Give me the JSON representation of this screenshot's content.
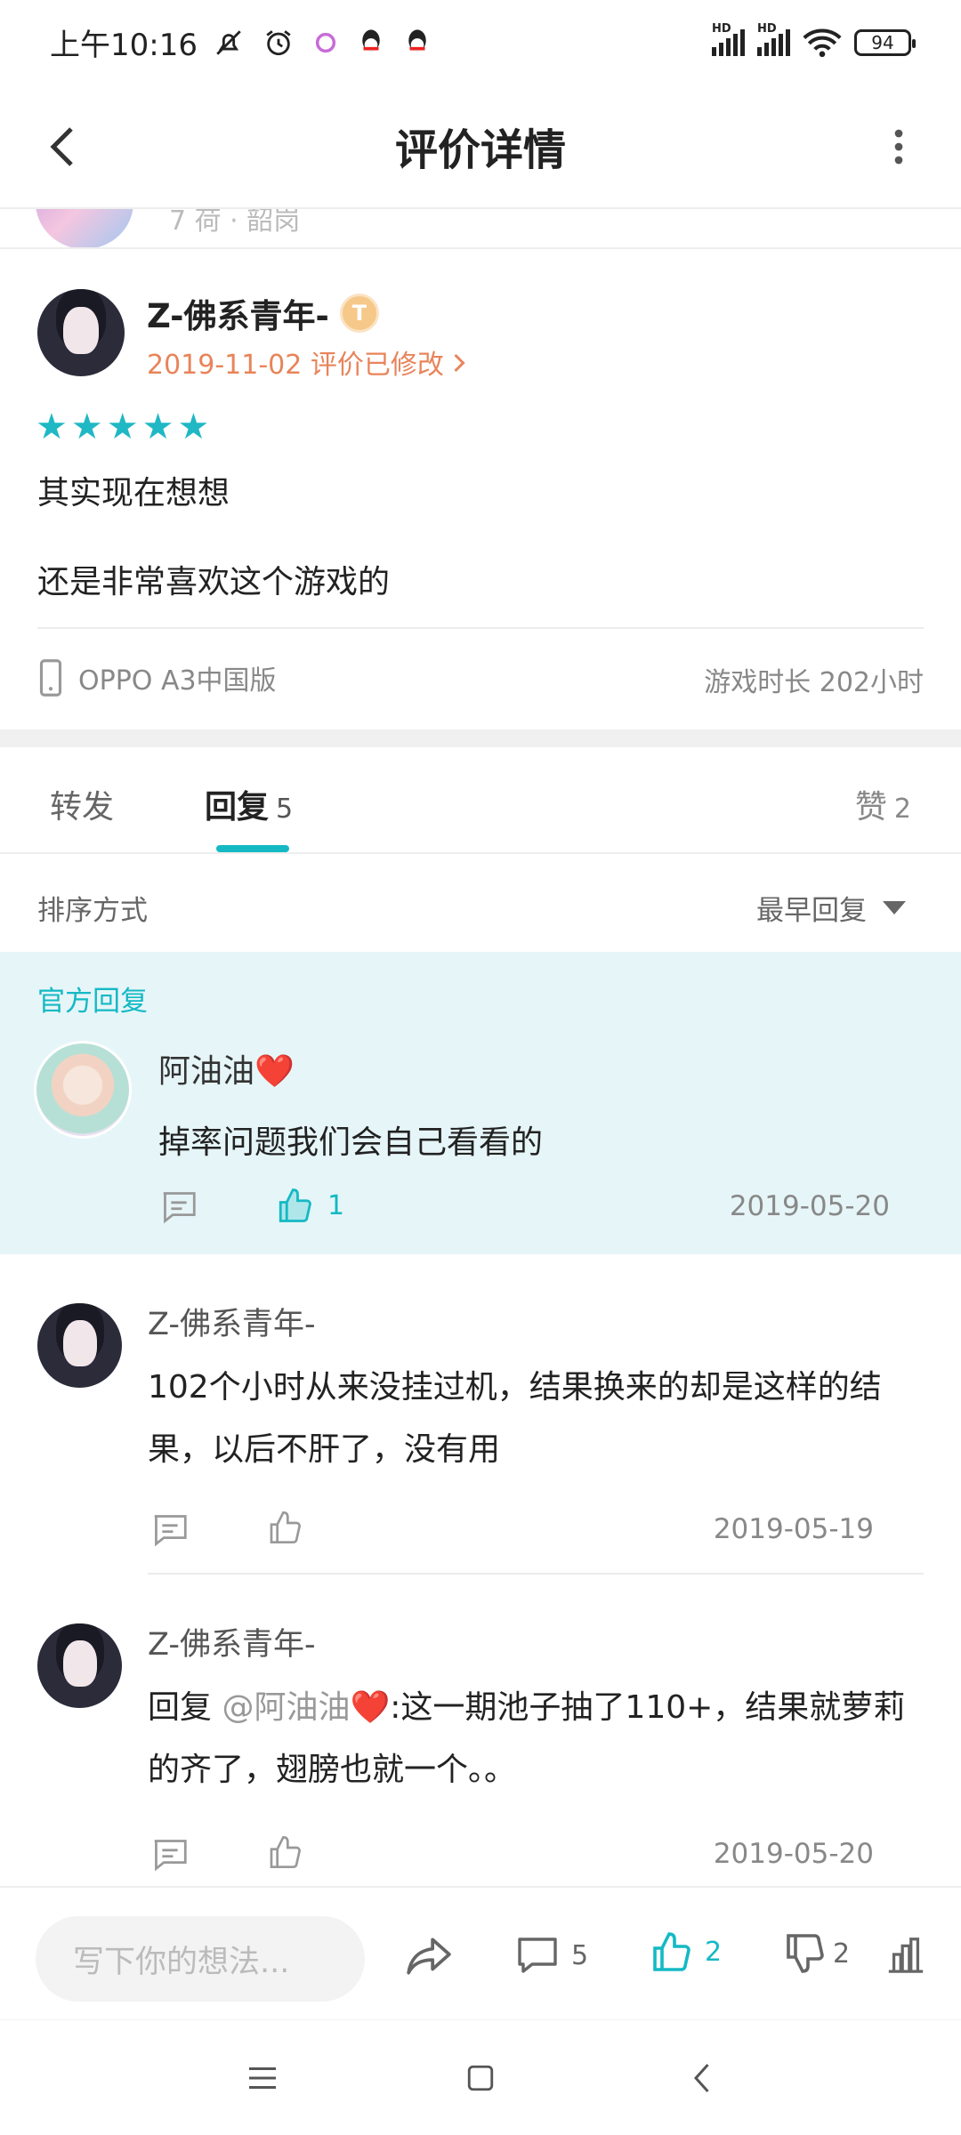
{
  "status_bar": {
    "time": "上午10:16",
    "battery": "94",
    "hd_label": "HD"
  },
  "app_bar": {
    "title": "评价详情"
  },
  "peek": {
    "text": "7 荷 · 韶岗"
  },
  "review": {
    "username": "Z-佛系青年-",
    "badge": "T",
    "date": "2019-11-02 评价已修改",
    "stars": 5,
    "text_line1": "其实现在想想",
    "text_line2": "还是非常喜欢这个游戏的",
    "device": "OPPO A3中国版",
    "playtime": "游戏时长 202小时"
  },
  "tabs": {
    "forward": "转发",
    "reply": "回复",
    "reply_count": "5",
    "like": "赞",
    "like_count": "2"
  },
  "sort": {
    "label": "排序方式",
    "value": "最早回复"
  },
  "official_reply": {
    "tag": "官方回复",
    "name": "阿油油❤️",
    "text": "掉率问题我们会自己看看的",
    "like_count": "1",
    "date": "2019-05-20"
  },
  "comments": [
    {
      "name": "Z-佛系青年-",
      "text": "102个小时从来没挂过机，结果换来的却是这样的结果，以后不肝了，没有用",
      "date": "2019-05-19"
    },
    {
      "name": "Z-佛系青年-",
      "prefix": "回复 ",
      "mention": "@阿油油❤️",
      "text": ":这一期池子抽了110+，结果就萝莉的齐了，翅膀也就一个。。",
      "date": "2019-05-20"
    }
  ],
  "bottom_bar": {
    "placeholder": "写下你的想法...",
    "comment_count": "5",
    "like_count": "2",
    "dislike_count": "2"
  },
  "colors": {
    "accent": "#14b9c4",
    "date_orange": "#e8845a",
    "official_bg": "#e6f5f8"
  }
}
